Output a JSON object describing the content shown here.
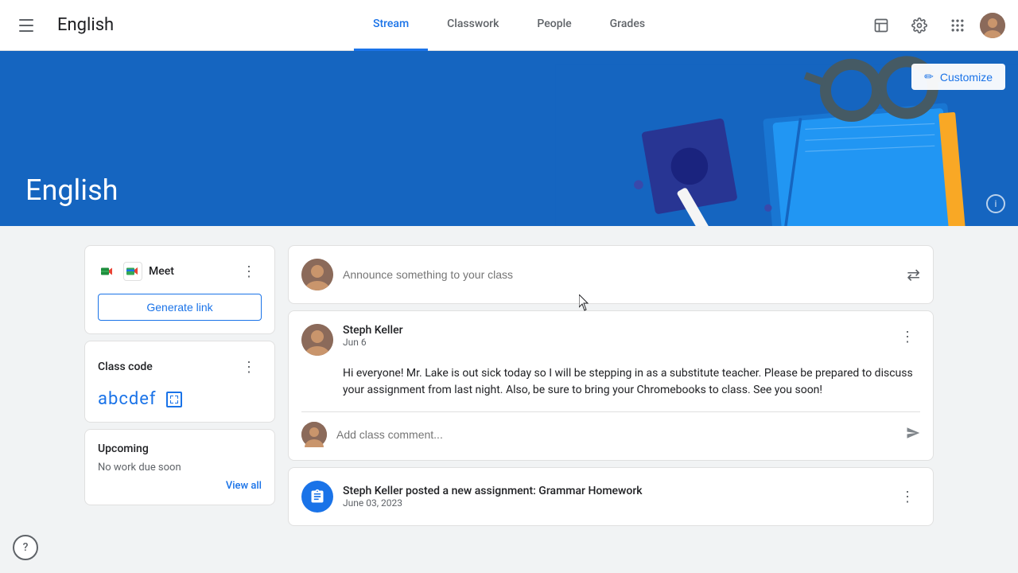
{
  "header": {
    "title": "English",
    "nav_tabs": [
      {
        "label": "Stream",
        "active": true
      },
      {
        "label": "Classwork",
        "active": false
      },
      {
        "label": "People",
        "active": false
      },
      {
        "label": "Grades",
        "active": false
      }
    ]
  },
  "banner": {
    "title": "English",
    "customize_label": "Customize",
    "info_label": "i"
  },
  "sidebar": {
    "meet_label": "Meet",
    "generate_link_label": "Generate link",
    "class_code_section_label": "Class code",
    "class_code_value": "abcdef",
    "upcoming_label": "Upcoming",
    "no_work_label": "No work due soon",
    "view_all_label": "View all"
  },
  "stream": {
    "announce_placeholder": "Announce something to your class",
    "comment_placeholder": "Add class comment...",
    "posts": [
      {
        "author": "Steph Keller",
        "date": "Jun 6",
        "body": "Hi everyone! Mr. Lake is out sick today so I will be stepping in as a substitute teacher. Please be prepared to discuss your assignment from last night. Also, be sure to bring your Chromebooks to class. See you soon!"
      }
    ],
    "assignments": [
      {
        "title": "Steph Keller posted a new assignment: Grammar Homework",
        "date": "June 03, 2023"
      }
    ]
  },
  "icons": {
    "hamburger": "☰",
    "customize_pencil": "✏",
    "three_dot": "⋮",
    "swap": "⇄",
    "send": "➤",
    "info": "i",
    "assignment": "📋",
    "expand": "⛶"
  },
  "colors": {
    "blue": "#1a73e8",
    "banner_bg": "#1565c0",
    "text_primary": "#202124",
    "text_secondary": "#5f6368"
  }
}
